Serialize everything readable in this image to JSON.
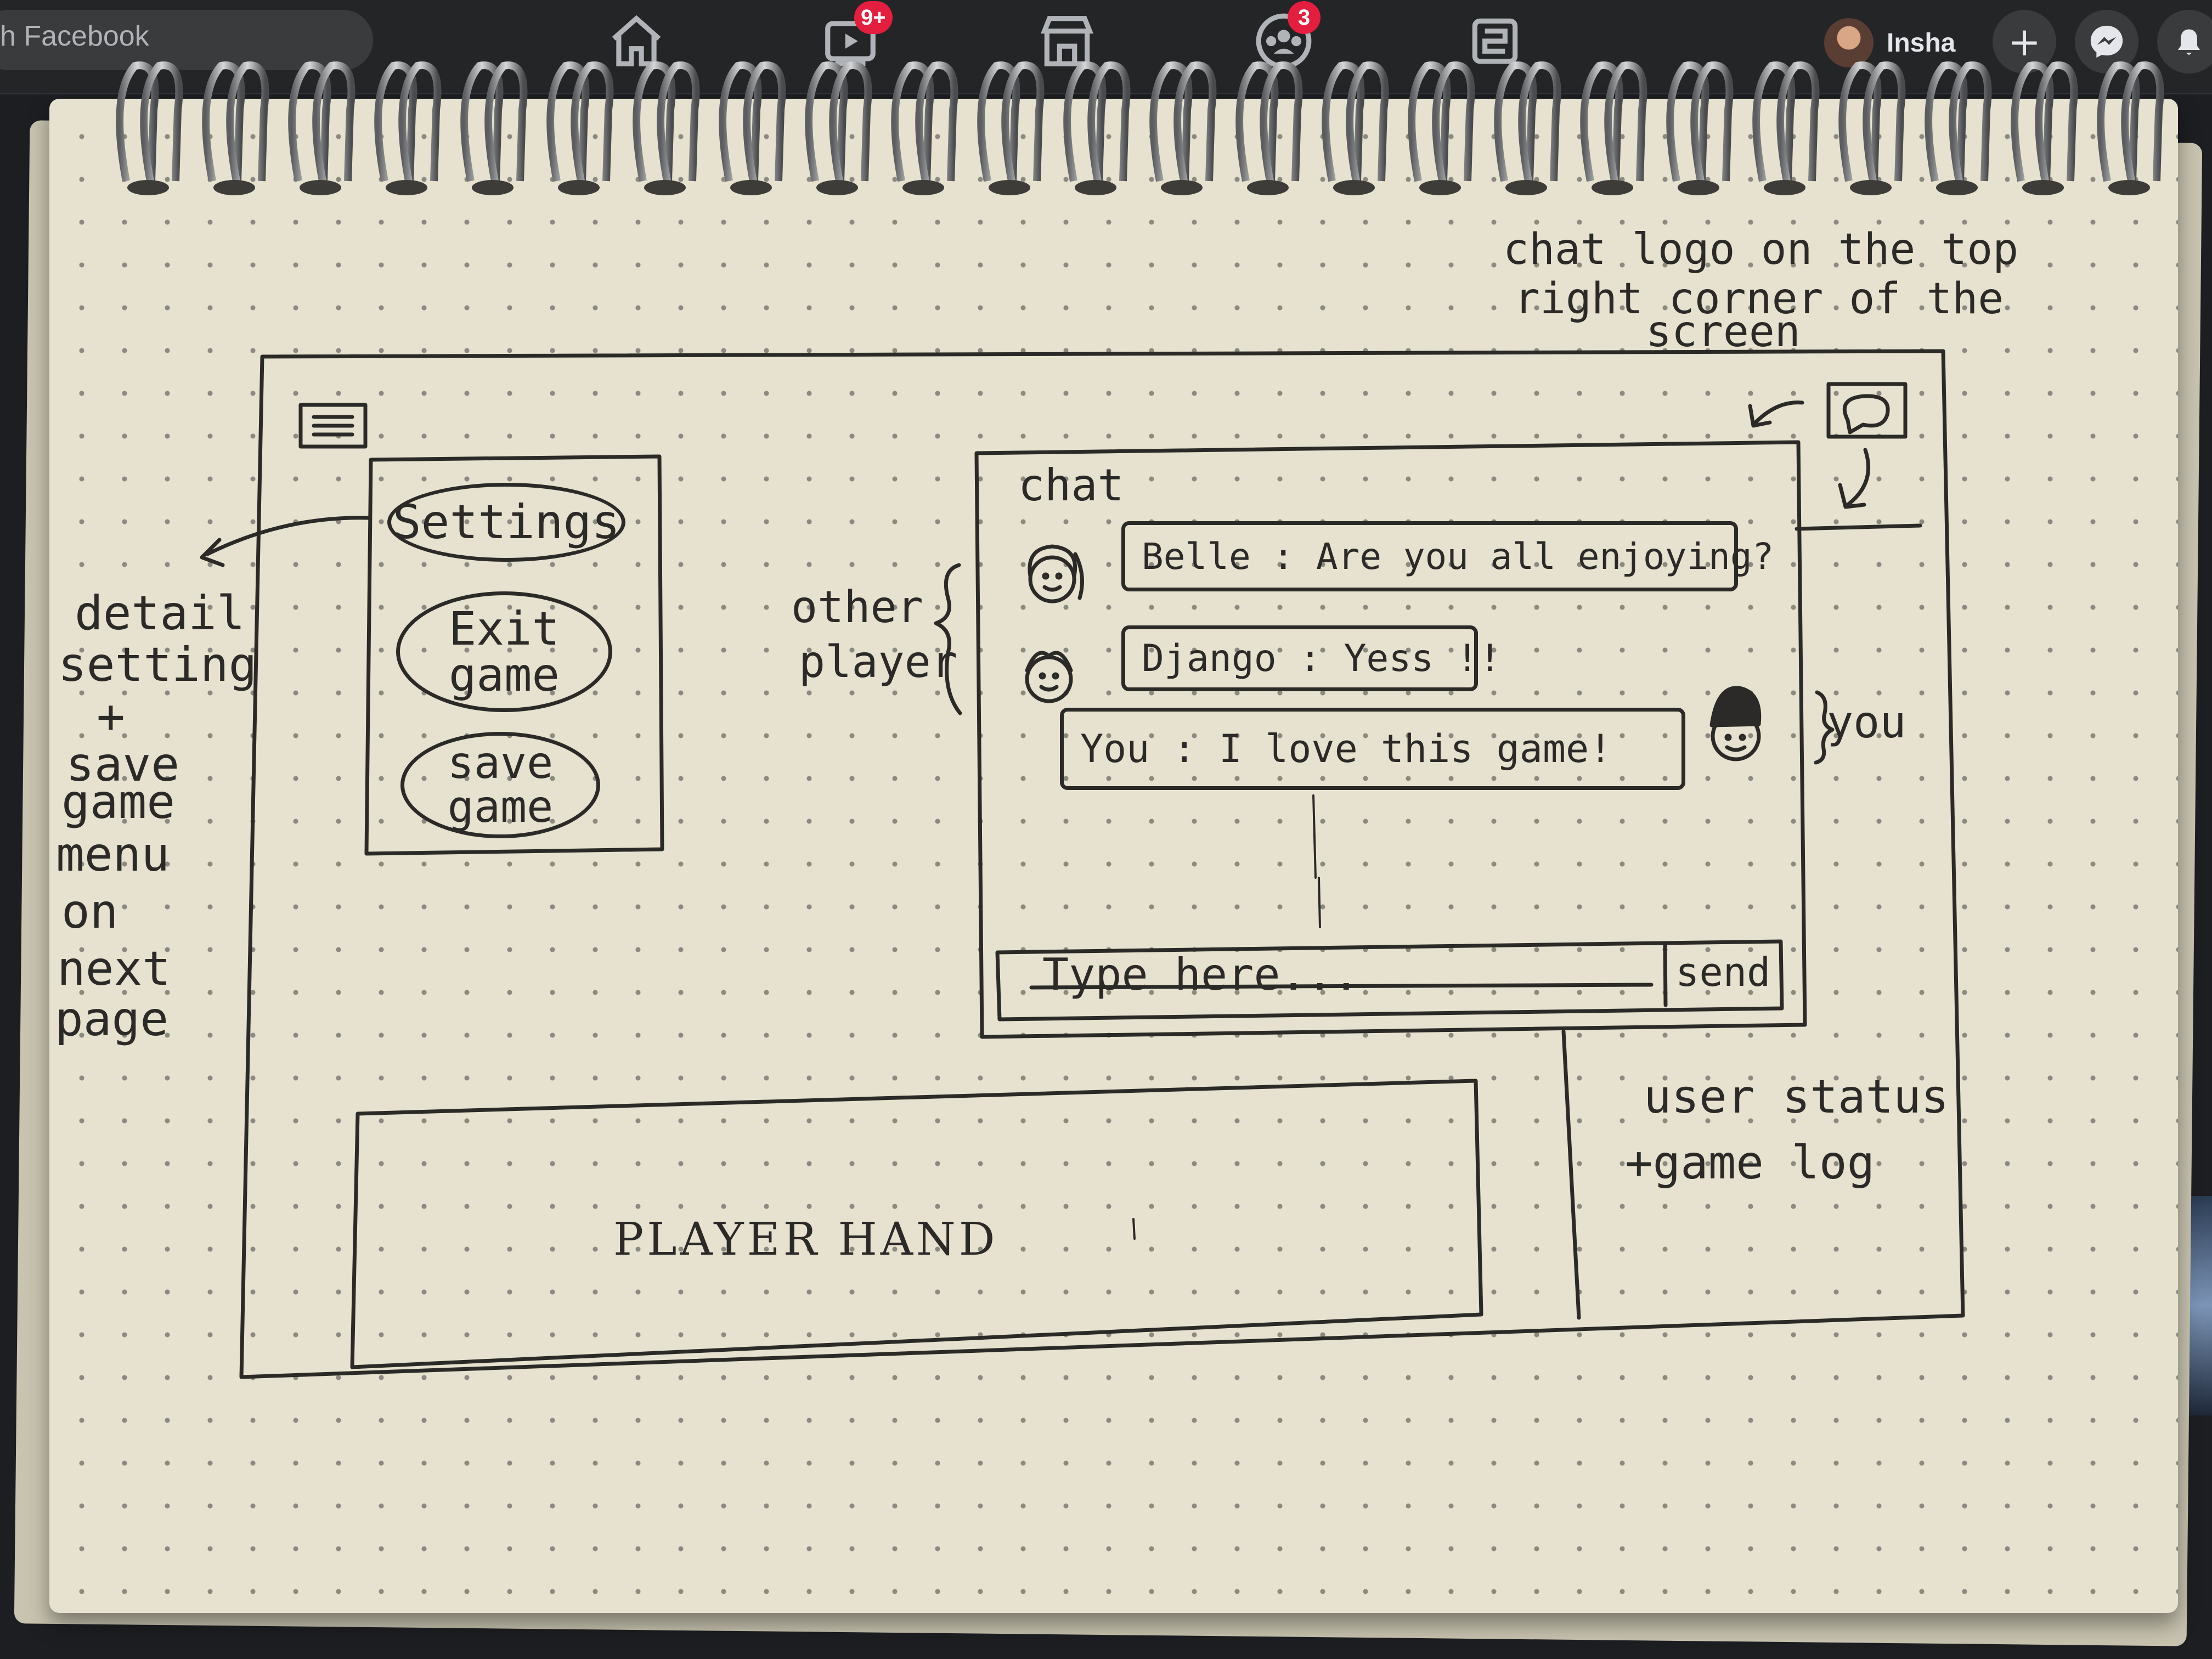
{
  "browser": {
    "search_text": "h Facebook",
    "nav": [
      {
        "icon": "home-icon",
        "badge": ""
      },
      {
        "icon": "watch-icon",
        "badge": "9+"
      },
      {
        "icon": "marketplace-icon",
        "badge": ""
      },
      {
        "icon": "groups-icon",
        "badge": "3"
      },
      {
        "icon": "gaming-icon",
        "badge": ""
      }
    ],
    "user_name": "Insha",
    "create_symbol": "+",
    "badge_color": "#e41e3f"
  },
  "sketch": {
    "top_note": {
      "line1": "chat logo on the top",
      "line2": "right corner of the",
      "line3": "screen"
    },
    "menu_icon": "hamburger-menu-icon",
    "chat_logo_icon": "chat-icon",
    "left_note": [
      "detail",
      "setting",
      "+",
      "save",
      "game",
      "menu",
      "on",
      "next",
      "page"
    ],
    "settings_panel": {
      "settings_label": "Settings",
      "exit_label_1": "Exit",
      "exit_label_2": "game",
      "save_label_1": "save",
      "save_label_2": "game"
    },
    "other_player_note": {
      "line1": "other",
      "line2": "player"
    },
    "chat": {
      "title": "chat",
      "messages": [
        {
          "text": "Belle : Are you all enjoying?",
          "avatar": "belle-avatar-icon"
        },
        {
          "text": "Django : Yess !!",
          "avatar": "django-avatar-icon"
        },
        {
          "text": "You : I love this game!",
          "avatar": "you-avatar-icon"
        }
      ],
      "input_placeholder": "Type here...",
      "send_label": "send"
    },
    "you_note": "you",
    "status_note": {
      "line1": "user status",
      "line2": "+game log"
    },
    "player_hand_label": "PLAYER  HAND"
  }
}
